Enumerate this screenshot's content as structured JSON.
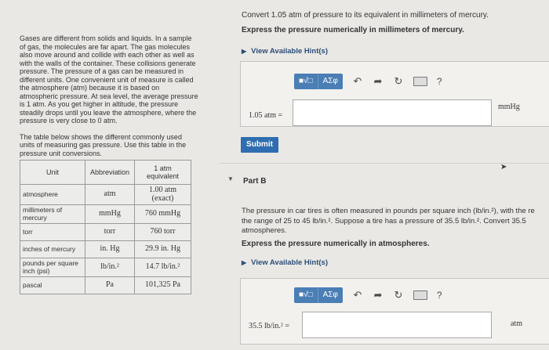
{
  "left": {
    "intro": "Gases are different from solids and liquids. In a sample of gas, the molecules are far apart. The gas molecules also move around and collide with each other as well as with the walls of the container. These collisions generate pressure. The pressure of a gas can be measured in different units. One convenient unit of measure is called the atmosphere (atm) because it is based on atmospheric pressure. At sea level, the average pressure is 1 atm. As you get higher in altitude, the pressure steadily drops until you leave the atmosphere, where the pressure is very close to 0 atm.",
    "table_intro": "The table below shows the different commonly used units of measuring gas pressure. Use this table in the pressure unit conversions.",
    "table": {
      "headers": [
        "Unit",
        "Abbreviation",
        "1 atm equivalent"
      ],
      "rows": [
        [
          "atmosphere",
          "atm",
          "1.00 atm (exact)"
        ],
        [
          "millimeters of mercury",
          "mmHg",
          "760 mmHg"
        ],
        [
          "torr",
          "torr",
          "760 torr"
        ],
        [
          "inches of mercury",
          "in. Hg",
          "29.9 in. Hg"
        ],
        [
          "pounds per square inch (psi)",
          "lb/in.²",
          "14.7 lb/in.²"
        ],
        [
          "pascal",
          "Pa",
          "101,325 Pa"
        ]
      ]
    }
  },
  "partA": {
    "question": "Convert 1.05 atm of pressure to its equivalent in millimeters of mercury.",
    "instruction": "Express the pressure numerically in millimeters of mercury.",
    "hints_label": "View Available Hint(s)",
    "toolbar": {
      "sqrt_label": "■√□",
      "greek_label": "ΑΣφ",
      "undo_icon": "undo-icon",
      "redo_icon": "redo-icon",
      "reset_icon": "reset-icon",
      "keyboard_icon": "keyboard-icon",
      "help_label": "?"
    },
    "field_label": "1.05 atm =",
    "field_value": "",
    "unit": "mmHg",
    "submit_label": "Submit"
  },
  "partB": {
    "title": "Part B",
    "text_line1": "The pressure in car tires is often measured in pounds per square inch (lb/in.²), with the re",
    "text_line2": "the range of 25 to 45 lb/in.². Suppose a tire has a pressure of 35.5 lb/in.². Convert 35.5",
    "text_line3": "atmospheres.",
    "instruction": "Express the pressure numerically in atmospheres.",
    "hints_label": "View Available Hint(s)",
    "field_label": "35.5 lb/in.² =",
    "field_value": "",
    "unit": "atm"
  },
  "colors": {
    "accent": "#2f6db0",
    "toolbar_blue": "#4a7eb5",
    "link": "#2d4e78"
  }
}
